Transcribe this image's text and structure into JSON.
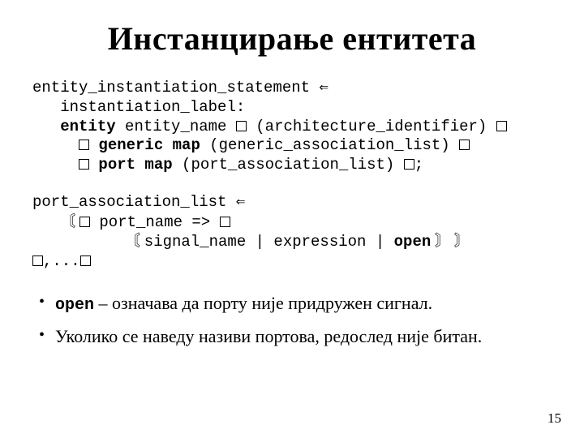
{
  "title": "Инстанцирање ентитета",
  "code1": {
    "l1a": "entity_instantiation_statement ",
    "l1b": "⇐",
    "l2": "   instantiation_label:",
    "l3a": "   ",
    "l3b": "entity",
    "l3c": " entity_name ",
    "l3d": " (architecture_identifier) ",
    "l4a": "     ",
    "l4b": " ",
    "l4c": "generic map",
    "l4d": " (generic_association_list) ",
    "l5a": "     ",
    "l5b": " ",
    "l5c": "port map",
    "l5d": " (port_association_list) ",
    "l5e": ";"
  },
  "code2": {
    "l1a": "port_association_list ",
    "l1b": "⇐",
    "l2a": "   ",
    "l2b": "〘 ",
    "l2c": " port_name => ",
    "l3a": "          ",
    "l3b": "〘 ",
    "l3c": "signal_name | expression | ",
    "l3d": "open",
    "l3e": " 〙 〙",
    "l4a": "",
    "l4b": ",...",
    "l4c": ""
  },
  "bullets": {
    "b1_code": "open",
    "b1_rest": " – означава да порту није придружен сигнал.",
    "b2": "Уколико се наведу називи портова, редослед није битан."
  },
  "pagenum": "15"
}
